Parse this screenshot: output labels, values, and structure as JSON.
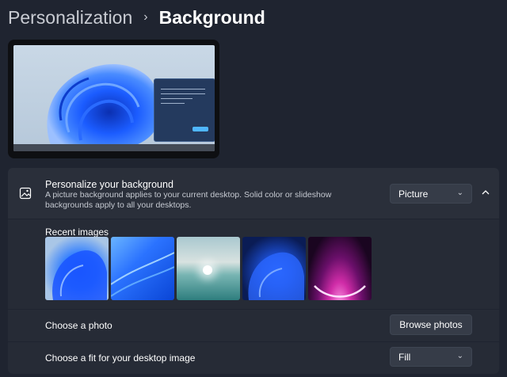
{
  "breadcrumb": {
    "parent": "Personalization",
    "separator": "›",
    "current": "Background"
  },
  "personalize": {
    "title": "Personalize your background",
    "description": "A picture background applies to your current desktop. Solid color or slideshow backgrounds apply to all your desktops.",
    "type_value": "Picture",
    "icon": "picture-icon",
    "collapse_icon": "chevron-up-icon"
  },
  "recent": {
    "label": "Recent images",
    "images": [
      "bloom-blue-light",
      "blue-waves",
      "lake-sunrise",
      "bloom-blue-dark",
      "purple-glow"
    ]
  },
  "choose_photo": {
    "label": "Choose a photo",
    "button": "Browse photos"
  },
  "fit": {
    "label": "Choose a fit for your desktop image",
    "value": "Fill"
  },
  "colors": {
    "accent": "#4fb6ff",
    "background": "#1f2430",
    "card": "#2a2f3a"
  }
}
